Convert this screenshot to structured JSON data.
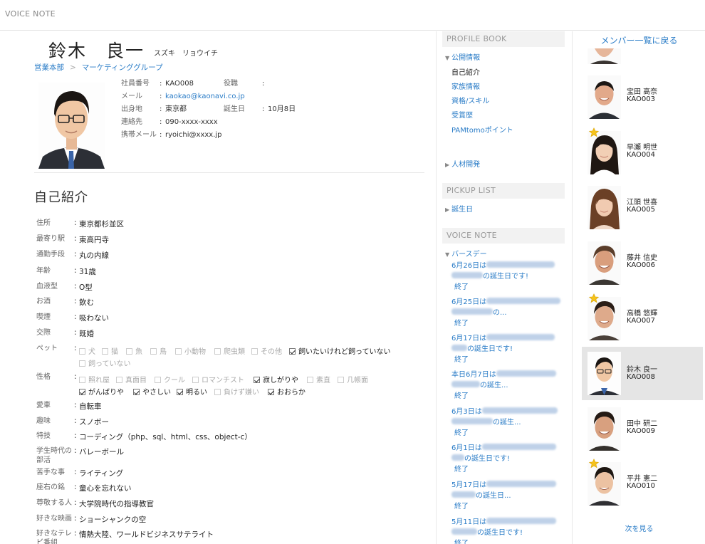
{
  "app": {
    "title": "VOICE NOTE"
  },
  "profile": {
    "name": "鈴木　良一",
    "kana": "スズキ　リョウイチ",
    "breadcrumb": [
      "営業本部",
      "マーケティンググループ"
    ],
    "info": {
      "emp_no_label": "社員番号",
      "emp_no": "KAO008",
      "title_label": "役職",
      "title": "",
      "mail_label": "メール",
      "mail": "kaokao@kaonavi.co.jp",
      "from_label": "出身地",
      "from": "東京都",
      "birthday_label": "誕生日",
      "birthday": "10月8日",
      "contact_label": "連絡先",
      "contact": "090-xxxx-xxxx",
      "mobile_label": "携帯メール",
      "mobile": "ryoichi@xxxx.jp"
    }
  },
  "section_title": "自己紹介",
  "fields": {
    "address": {
      "label": "住所",
      "value": "東京都杉並区"
    },
    "station": {
      "label": "最寄り駅",
      "value": "東高円寺"
    },
    "commute": {
      "label": "通勤手段",
      "value": "丸の内線"
    },
    "age": {
      "label": "年齢",
      "value": "31歳"
    },
    "blood": {
      "label": "血液型",
      "value": "O型"
    },
    "drink": {
      "label": "お酒",
      "value": "飲む"
    },
    "smoke": {
      "label": "喫煙",
      "value": "吸わない"
    },
    "marriage": {
      "label": "交際",
      "value": "既婚"
    },
    "pet": {
      "label": "ペット",
      "options": [
        {
          "label": "犬",
          "checked": false
        },
        {
          "label": "猫",
          "checked": false
        },
        {
          "label": "魚",
          "checked": false
        },
        {
          "label": "鳥",
          "checked": false
        },
        {
          "label": "小動物",
          "checked": false
        },
        {
          "label": "爬虫類",
          "checked": false
        },
        {
          "label": "その他",
          "checked": false
        },
        {
          "label": "飼いたいけれど飼っていない",
          "checked": true
        },
        {
          "label": "飼っていない",
          "checked": false
        }
      ]
    },
    "personality": {
      "label": "性格",
      "options": [
        {
          "label": "照れ屋",
          "checked": false
        },
        {
          "label": "真面目",
          "checked": false
        },
        {
          "label": "クール",
          "checked": false
        },
        {
          "label": "ロマンチスト",
          "checked": false
        },
        {
          "label": "寂しがりや",
          "checked": true
        },
        {
          "label": "素直",
          "checked": false
        },
        {
          "label": "几帳面",
          "checked": false
        },
        {
          "label": "がんばりや",
          "checked": true
        },
        {
          "label": "やさしい",
          "checked": true
        },
        {
          "label": "明るい",
          "checked": true
        },
        {
          "label": "負けず嫌い",
          "checked": false
        },
        {
          "label": "おおらか",
          "checked": true
        }
      ]
    },
    "car": {
      "label": "愛車",
      "value": "自転車"
    },
    "hobby": {
      "label": "趣味",
      "value": "スノボー"
    },
    "skill": {
      "label": "特技",
      "value": "コーディング（php、sql、html、css、object-c）"
    },
    "club": {
      "label": "学生時代の部活",
      "value": "バレーボール"
    },
    "weak": {
      "label": "苦手な事",
      "value": "ライティング"
    },
    "motto": {
      "label": "座右の銘",
      "value": "童心を忘れない"
    },
    "respect": {
      "label": "尊敬する人",
      "value": "大学院時代の指導教官"
    },
    "movie": {
      "label": "好きな映画",
      "value": "ショーシャンクの空"
    },
    "tv": {
      "label": "好きなテレビ番組",
      "value": "情熱大陸、ワールドビジネスサテライト"
    }
  },
  "profile_book": {
    "heading": "PROFILE BOOK",
    "public_label": "公開情報",
    "items": [
      "自己紹介",
      "家族情報",
      "資格/スキル",
      "受賞歴",
      "PAMtomoポイント"
    ],
    "development_label": "人材開発"
  },
  "pickup": {
    "heading": "PICKUP LIST",
    "birthday_label": "誕生日"
  },
  "voice": {
    "heading": "VOICE NOTE",
    "birthday_label": "バースデー",
    "items": [
      {
        "date": "6月26日は",
        "suffix": "の誕生日です!",
        "end": "終了"
      },
      {
        "date": "6月25日は",
        "suffix": "の...",
        "end": "終了"
      },
      {
        "date": "6月17日は",
        "suffix": "の誕生日です!",
        "end": "終了"
      },
      {
        "date": "本日6月7日は",
        "suffix": "の誕生...",
        "end": "終了"
      },
      {
        "date": "6月3日は",
        "suffix": "の誕生...",
        "end": "終了"
      },
      {
        "date": "6月1日は",
        "suffix": "の誕生日です!",
        "end": "終了"
      },
      {
        "date": "5月17日は",
        "suffix": "の誕生日...",
        "end": "終了"
      },
      {
        "date": "5月11日は",
        "suffix": "の誕生日です!",
        "end": "終了"
      }
    ]
  },
  "members": {
    "back_label": "メンバー一覧に戻る",
    "more_label": "次を見る",
    "list": [
      {
        "name": "宝田 高奈",
        "id": "KAO003",
        "star": false,
        "selected": false
      },
      {
        "name": "早瀬 明世",
        "id": "KAO004",
        "star": true,
        "selected": false
      },
      {
        "name": "江頭 世喜",
        "id": "KAO005",
        "star": false,
        "selected": false
      },
      {
        "name": "藤井 信史",
        "id": "KAO006",
        "star": false,
        "selected": false
      },
      {
        "name": "高橋 悠輝",
        "id": "KAO007",
        "star": true,
        "selected": false
      },
      {
        "name": "鈴木 良一",
        "id": "KAO008",
        "star": false,
        "selected": true
      },
      {
        "name": "田中 研二",
        "id": "KAO009",
        "star": false,
        "selected": false
      },
      {
        "name": "平井 憲二",
        "id": "KAO010",
        "star": true,
        "selected": false
      }
    ]
  }
}
